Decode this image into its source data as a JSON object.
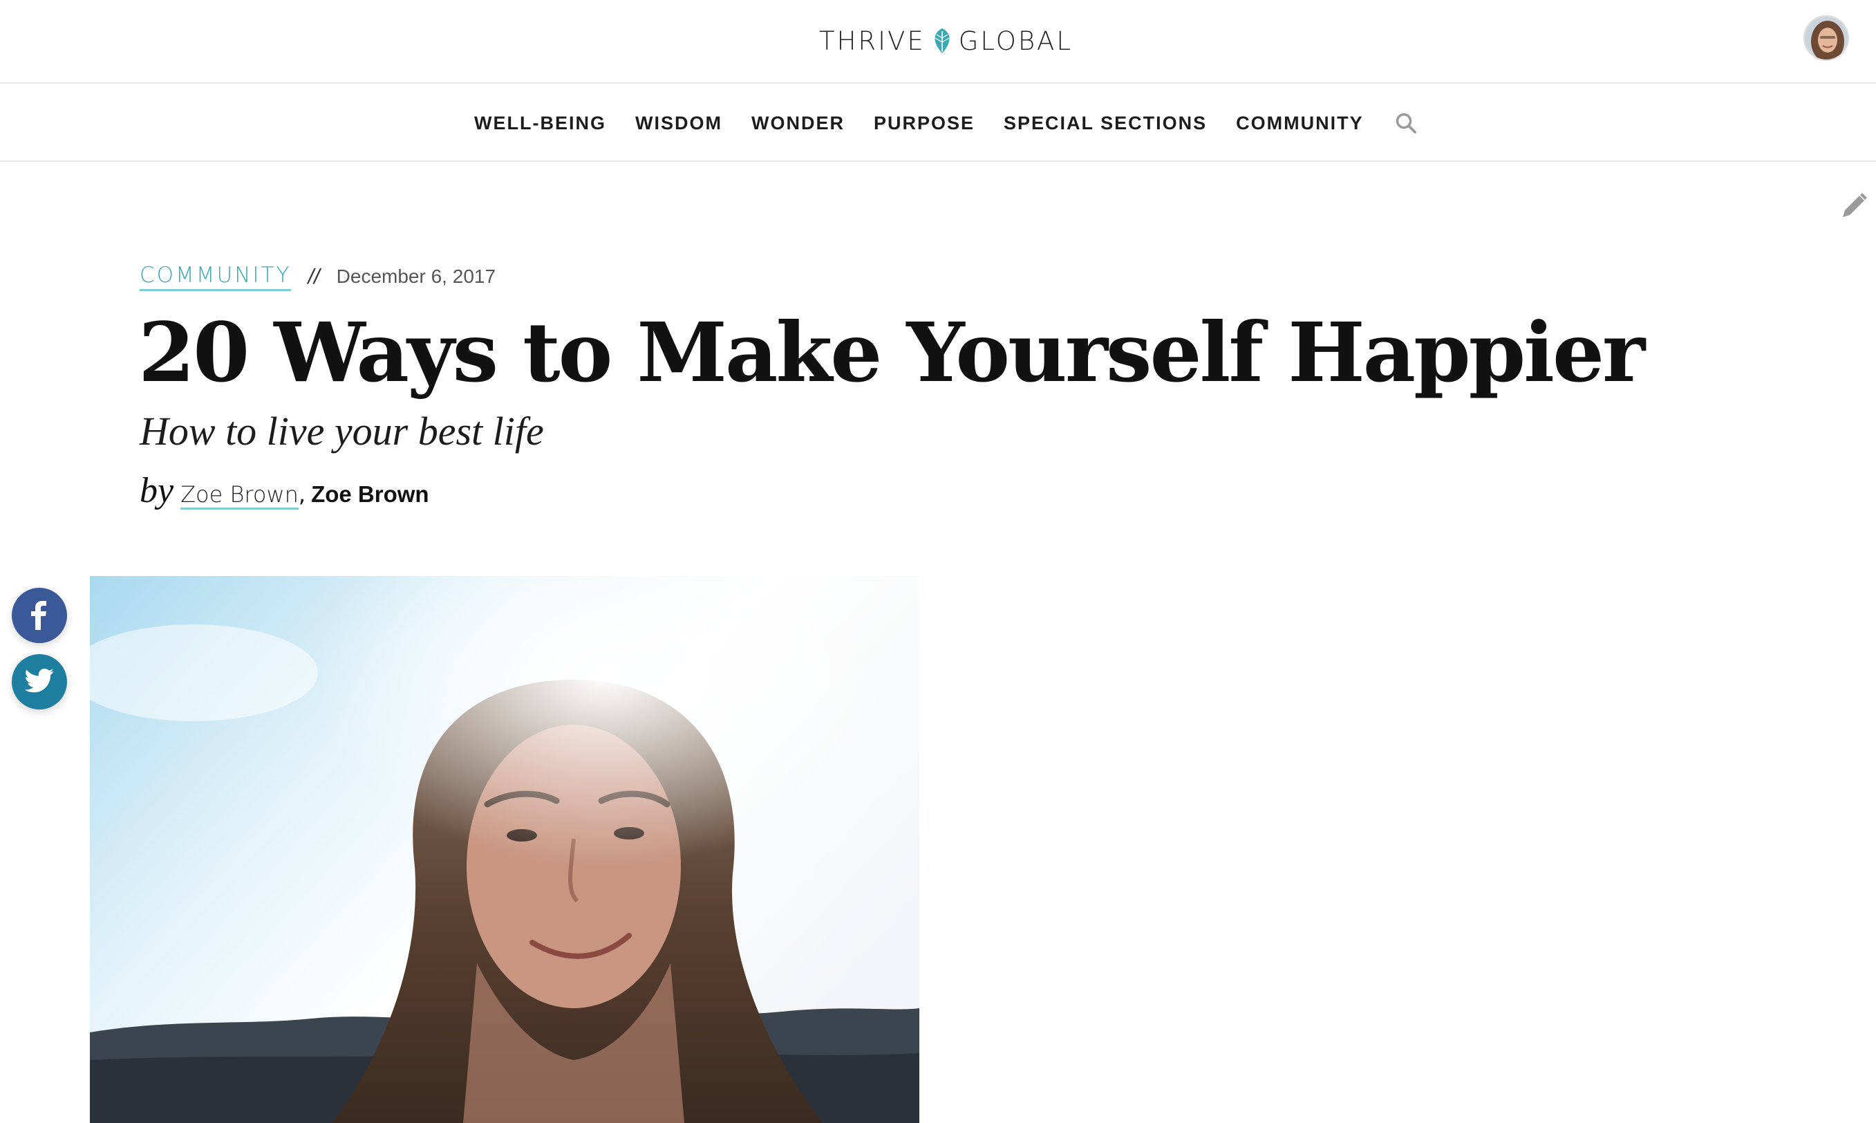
{
  "header": {
    "logo_left": "THRIVE",
    "logo_right": "GLOBAL",
    "brand_color": "#3aa9b1",
    "avatar_icon": "user-avatar"
  },
  "nav": {
    "items": [
      {
        "label": "WELL-BEING"
      },
      {
        "label": "WISDOM"
      },
      {
        "label": "WONDER"
      },
      {
        "label": "PURPOSE"
      },
      {
        "label": "SPECIAL SECTIONS"
      },
      {
        "label": "COMMUNITY"
      }
    ],
    "search_icon": "search-icon"
  },
  "article": {
    "category": "COMMUNITY",
    "separator": "//",
    "date": "December 6, 2017",
    "title": "20 Ways to Make Yourself Happier",
    "subtitle": "How to live your best life",
    "by_label": "by",
    "author_link": "Zoe Brown",
    "comma": ",",
    "author_bold": "Zoe Brown"
  },
  "share": {
    "facebook_icon": "facebook-icon",
    "twitter_icon": "twitter-icon",
    "facebook_color": "#3b5998",
    "twitter_color": "#1d7e9f"
  }
}
